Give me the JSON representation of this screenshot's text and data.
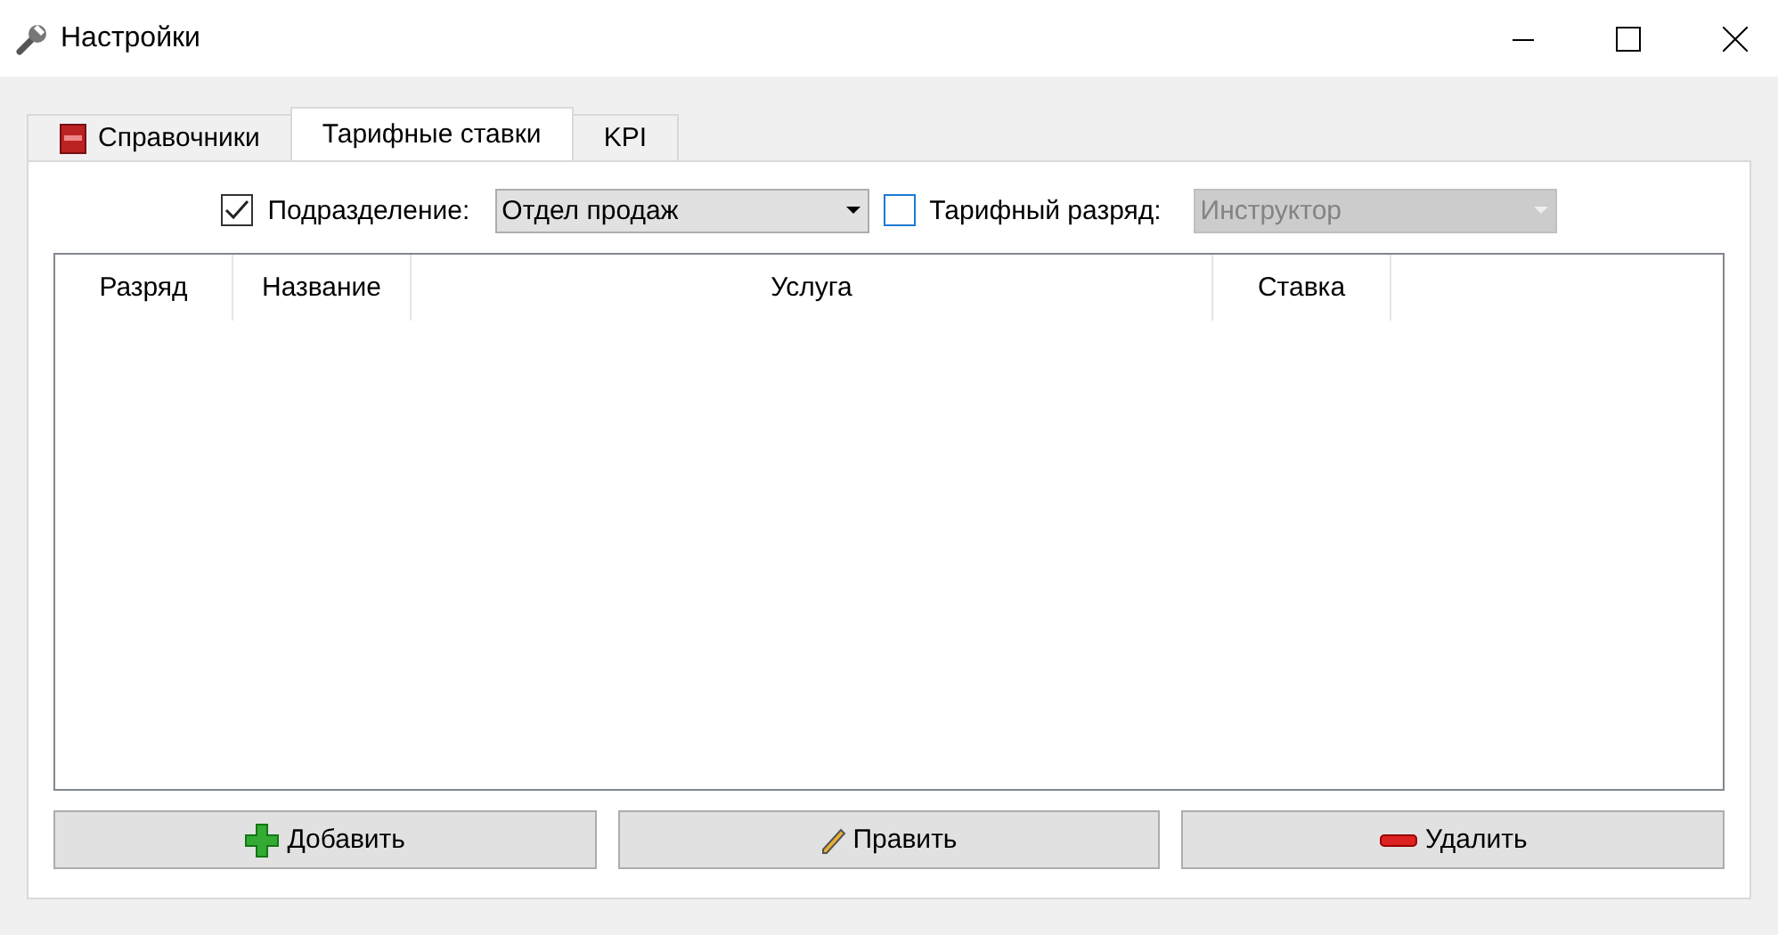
{
  "window": {
    "title": "Настройки"
  },
  "tabs": [
    {
      "label": "Справочники",
      "selected": false,
      "kind": "book"
    },
    {
      "label": "Тарифные ставки",
      "selected": true,
      "kind": "plain"
    },
    {
      "label": "KPI",
      "selected": false,
      "kind": "plain"
    }
  ],
  "filters": [
    {
      "label": "Подразделение:",
      "checked": true,
      "value": "Отдел продаж",
      "disabled": false
    },
    {
      "label": "Тарифный разряд:",
      "checked": false,
      "value": "Инструктор",
      "disabled": true
    }
  ],
  "table": {
    "columns": [
      "Разряд",
      "Название",
      "Услуга",
      "Ставка"
    ]
  },
  "buttons": [
    {
      "label": "Добавить",
      "kind": "add"
    },
    {
      "label": "Править",
      "kind": "edit"
    },
    {
      "label": "Удалить",
      "kind": "delete"
    }
  ]
}
